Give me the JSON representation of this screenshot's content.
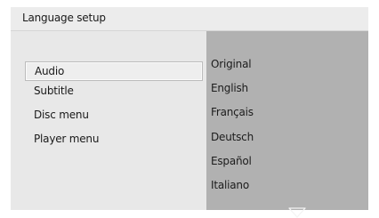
{
  "header": {
    "title": "Language setup"
  },
  "menu": {
    "items": [
      {
        "label": "Audio",
        "selected": true
      },
      {
        "label": "Subtitle"
      },
      {
        "label": "Disc menu"
      },
      {
        "label": "Player menu"
      }
    ]
  },
  "options": {
    "items": [
      {
        "label": "Original"
      },
      {
        "label": "English"
      },
      {
        "label": "Français"
      },
      {
        "label": "Deutsch"
      },
      {
        "label": "Español"
      },
      {
        "label": "Italiano"
      }
    ],
    "scroll_icon": "triangle-down-icon"
  },
  "colors": {
    "screen_bg": "#e7e7e7",
    "options_panel_bg": "#b1b1b1",
    "selection_border": "#bcbcbc"
  }
}
